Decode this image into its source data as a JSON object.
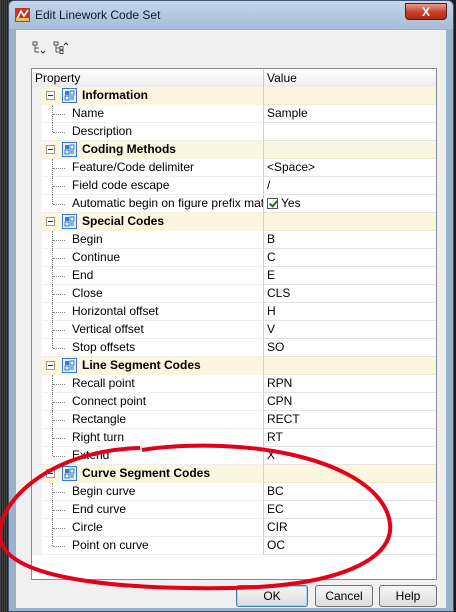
{
  "window": {
    "title": "Edit Linework Code Set",
    "close_label": "X"
  },
  "toolbar": {
    "buttons": [
      "collapse-all-icon",
      "expand-all-icon"
    ]
  },
  "grid": {
    "headers": {
      "property": "Property",
      "value": "Value"
    },
    "rows": [
      {
        "type": "category",
        "label": "Information",
        "value": ""
      },
      {
        "type": "prop",
        "label": "Name",
        "value": "Sample"
      },
      {
        "type": "prop",
        "label": "Description",
        "value": ""
      },
      {
        "type": "category",
        "label": "Coding Methods",
        "value": ""
      },
      {
        "type": "prop",
        "label": "Feature/Code delimiter",
        "value": "<Space>"
      },
      {
        "type": "prop",
        "label": "Field code escape",
        "value": "/"
      },
      {
        "type": "prop",
        "label": "Automatic begin on figure prefix match",
        "value": "Yes",
        "checkbox": true
      },
      {
        "type": "category",
        "label": "Special Codes",
        "value": ""
      },
      {
        "type": "prop",
        "label": "Begin",
        "value": "B"
      },
      {
        "type": "prop",
        "label": "Continue",
        "value": "C"
      },
      {
        "type": "prop",
        "label": "End",
        "value": "E"
      },
      {
        "type": "prop",
        "label": "Close",
        "value": "CLS"
      },
      {
        "type": "prop",
        "label": "Horizontal offset",
        "value": "H"
      },
      {
        "type": "prop",
        "label": "Vertical offset",
        "value": "V"
      },
      {
        "type": "prop",
        "label": "Stop offsets",
        "value": "SO"
      },
      {
        "type": "category",
        "label": "Line Segment Codes",
        "value": ""
      },
      {
        "type": "prop",
        "label": "Recall point",
        "value": "RPN"
      },
      {
        "type": "prop",
        "label": "Connect point",
        "value": "CPN"
      },
      {
        "type": "prop",
        "label": "Rectangle",
        "value": "RECT"
      },
      {
        "type": "prop",
        "label": "Right turn",
        "value": "RT"
      },
      {
        "type": "prop",
        "label": "Extend",
        "value": "X"
      },
      {
        "type": "category",
        "label": "Curve Segment Codes",
        "value": ""
      },
      {
        "type": "prop",
        "label": "Begin curve",
        "value": "BC"
      },
      {
        "type": "prop",
        "label": "End curve",
        "value": "EC"
      },
      {
        "type": "prop",
        "label": "Circle",
        "value": "CIR"
      },
      {
        "type": "prop",
        "label": "Point on curve",
        "value": "OC"
      }
    ]
  },
  "buttons": {
    "ok": "OK",
    "cancel": "Cancel",
    "help": "Help"
  },
  "colors": {
    "category_bg": "#fbf6dd",
    "annotation": "#e3001b",
    "close_button": "#c6402a"
  }
}
